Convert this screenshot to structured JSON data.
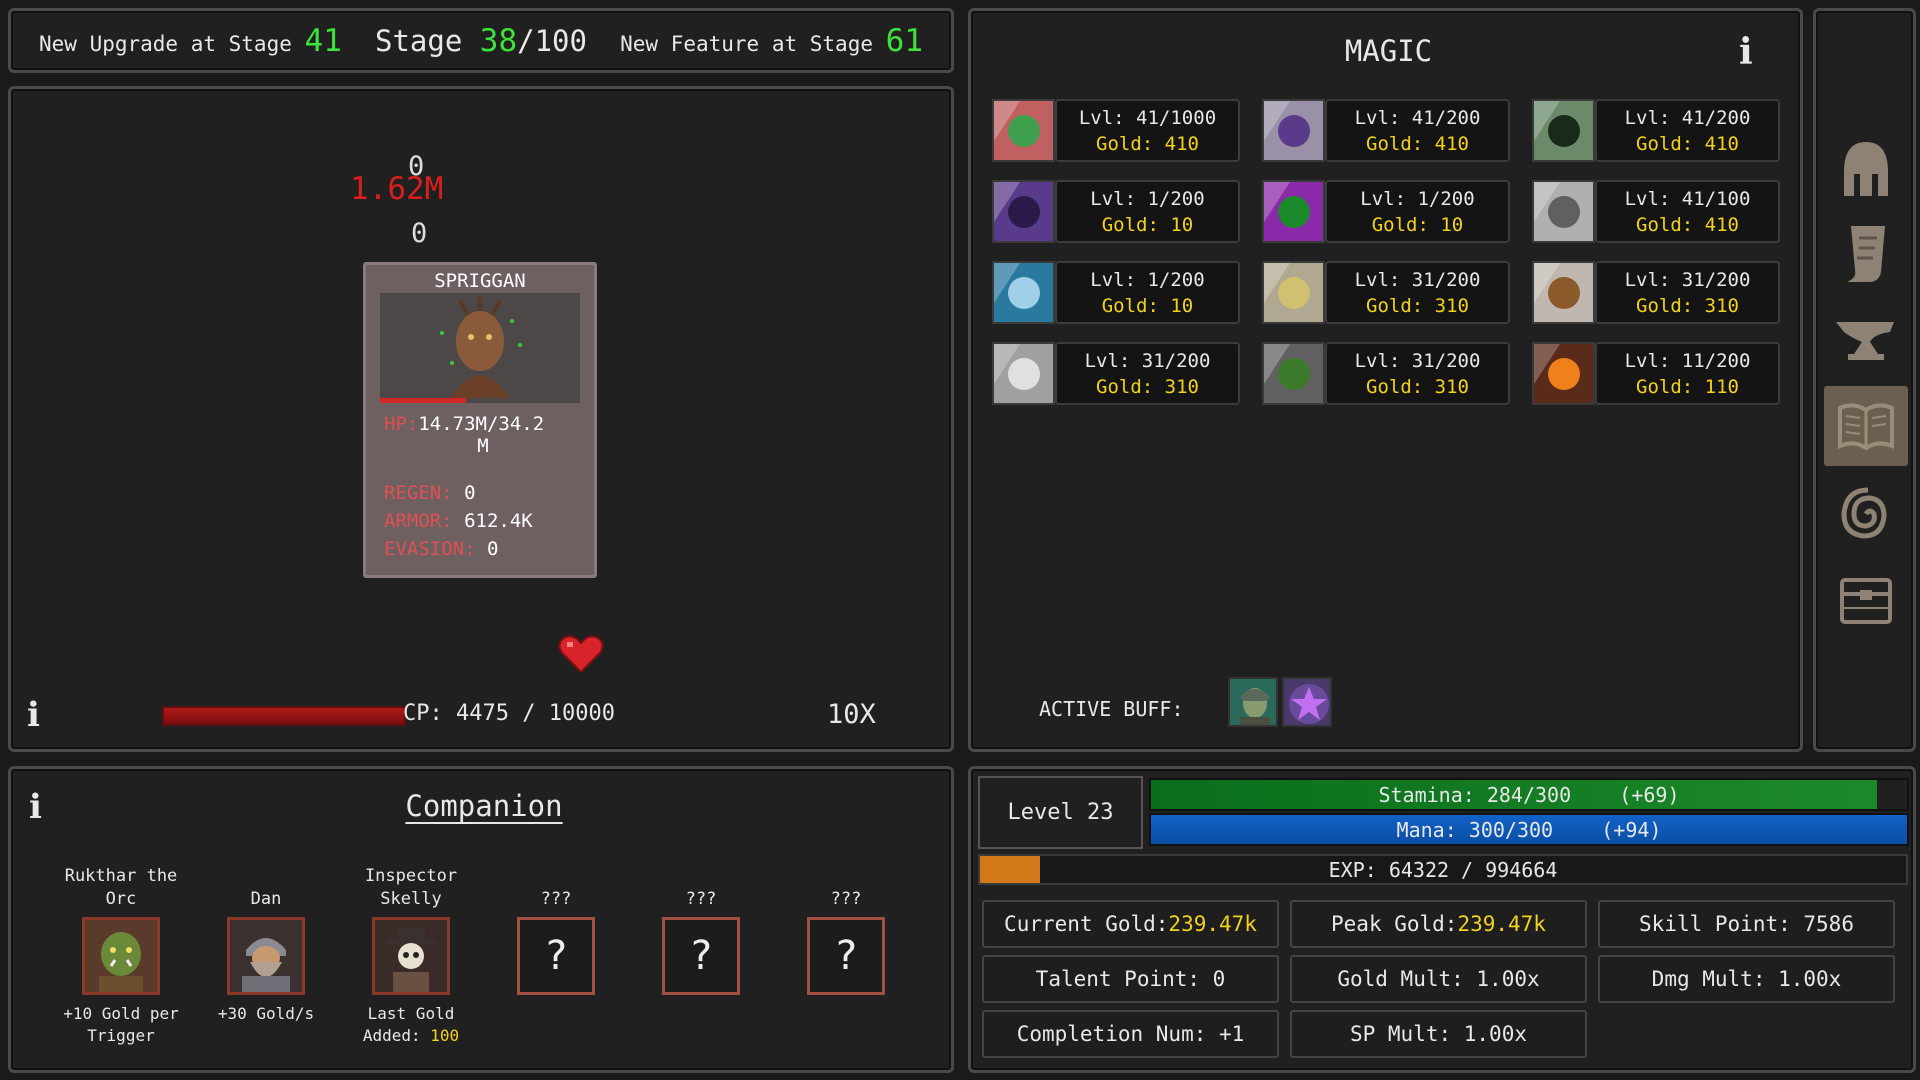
{
  "topbar": {
    "upgrade_label": "New Upgrade at Stage",
    "upgrade_stage": "41",
    "stage_label": "Stage",
    "stage_current": "38",
    "stage_max": "/100",
    "feature_label": "New Feature at Stage",
    "feature_stage": "61"
  },
  "battle": {
    "damage_top": "0",
    "damage_big": "1.62M",
    "damage_mid": "0",
    "enemy": {
      "name": "SPRIGGAN",
      "hp_fraction": 0.43,
      "hp_label": "HP:",
      "hp_value": "14.73M/34.2",
      "hp_value_wrap": "M",
      "regen_label": "REGEN:",
      "regen_value": "0",
      "armor_label": "ARMOR:",
      "armor_value": "612.4K",
      "evasion_label": "EVASION:",
      "evasion_value": "0"
    },
    "info_icon": "i",
    "cp_label": "CP:",
    "cp_value": "4475 / 10000",
    "cp_fraction": 0.4475,
    "speed": "10X"
  },
  "companion": {
    "info_icon": "i",
    "title": "Companion",
    "list": [
      {
        "name": "Rukthar the Orc",
        "desc": "+10 Gold per Trigger",
        "icon": "orc-portrait"
      },
      {
        "name": "Dan",
        "desc": "+30 Gold/s",
        "icon": "dwarf-portrait"
      },
      {
        "name": "Inspector Skelly",
        "desc_prefix": "Last Gold Added: ",
        "desc_value": "100",
        "icon": "skeleton-portrait"
      },
      {
        "name": "???",
        "slot": "?"
      },
      {
        "name": "???",
        "slot": "?"
      },
      {
        "name": "???",
        "slot": "?"
      }
    ]
  },
  "magic": {
    "title": "MAGIC",
    "info_icon": "i",
    "spells": [
      {
        "lvl": "Lvl: 41/1000",
        "gold": "Gold: 410",
        "icon": "leaf-spell-icon"
      },
      {
        "lvl": "Lvl: 41/200",
        "gold": "Gold: 410",
        "icon": "star-spell-icon"
      },
      {
        "lvl": "Lvl: 41/200",
        "gold": "Gold: 410",
        "icon": "cloak-spell-icon"
      },
      {
        "lvl": "Lvl: 1/200",
        "gold": "Gold: 10",
        "icon": "hood-spell-icon"
      },
      {
        "lvl": "Lvl: 1/200",
        "gold": "Gold: 10",
        "icon": "clover-spell-icon"
      },
      {
        "lvl": "Lvl: 41/100",
        "gold": "Gold: 410",
        "icon": "mist-spell-icon"
      },
      {
        "lvl": "Lvl: 1/200",
        "gold": "Gold: 10",
        "icon": "shield-spell-icon"
      },
      {
        "lvl": "Lvl: 31/200",
        "gold": "Gold: 310",
        "icon": "scroll-spell-icon"
      },
      {
        "lvl": "Lvl: 31/200",
        "gold": "Gold: 310",
        "icon": "ring-spell-icon"
      },
      {
        "lvl": "Lvl: 31/200",
        "gold": "Gold: 310",
        "icon": "skull-spell-icon"
      },
      {
        "lvl": "Lvl: 31/200",
        "gold": "Gold: 310",
        "icon": "potion-spell-icon"
      },
      {
        "lvl": "Lvl: 11/200",
        "gold": "Gold: 110",
        "icon": "fire-sword-spell-icon"
      }
    ],
    "active_buff_label": "ACTIVE BUFF:",
    "buffs": [
      "warrior-buff-icon",
      "star-buff-icon"
    ]
  },
  "sidebar": {
    "items": [
      "helmet-icon",
      "scroll-icon",
      "anvil-icon",
      "spellbook-icon",
      "spiral-icon",
      "chest-icon"
    ],
    "active": "spellbook-icon"
  },
  "stats": {
    "level": "Level 23",
    "stamina": "Stamina: 284/300",
    "stamina_regen": "(+69)",
    "stamina_fraction": 0.947,
    "mana": "Mana: 300/300",
    "mana_regen": "(+94)",
    "mana_fraction": 1.0,
    "exp": "EXP: 64322 / 994664",
    "exp_fraction": 0.0647,
    "current_gold_label": "Current Gold: ",
    "current_gold": "239.47k",
    "peak_gold_label": "Peak Gold: ",
    "peak_gold": "239.47k",
    "skill_point": "Skill Point: 7586",
    "talent_point": "Talent Point: 0",
    "gold_mult": "Gold Mult: 1.00x",
    "dmg_mult": "Dmg Mult: 1.00x",
    "completion_num": "Completion Num: +1",
    "sp_mult": "SP Mult: 1.00x"
  },
  "colors": {
    "accent_green": "#3de23a",
    "gold": "#f3d21b",
    "damage_red": "#d91d1d"
  }
}
